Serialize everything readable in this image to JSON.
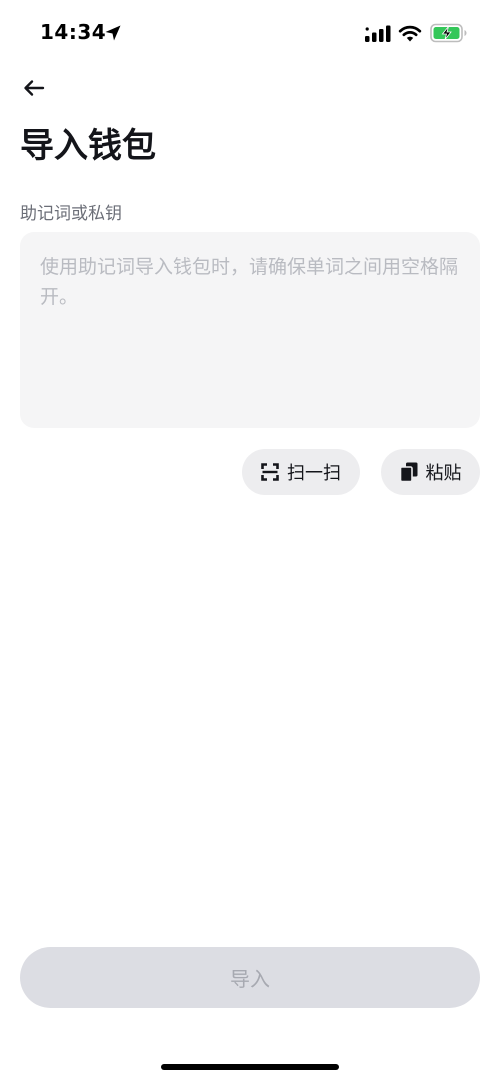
{
  "status_bar": {
    "time": "14:34",
    "icons": [
      "location-arrow-icon",
      "cellular-signal-icon",
      "wifi-icon",
      "battery-charging-icon"
    ],
    "battery_color": "#34c759"
  },
  "header": {
    "back_icon": "arrow-left-icon",
    "title": "导入钱包"
  },
  "form": {
    "label": "助记词或私钥",
    "input_value": "",
    "input_placeholder": "使用助记词导入钱包时，请确保单词之间用空格隔开。"
  },
  "actions": {
    "scan_label": "扫一扫",
    "scan_icon": "scan-icon",
    "paste_label": "粘贴",
    "paste_icon": "paste-icon"
  },
  "footer": {
    "import_label": "导入",
    "import_disabled": true
  },
  "colors": {
    "text_primary": "#14151a",
    "label": "#6b6e77",
    "input_bg": "#f5f5f6",
    "pill_bg": "#ededef",
    "disabled_bg": "#dcdde3",
    "disabled_text": "#a7a9b1"
  }
}
